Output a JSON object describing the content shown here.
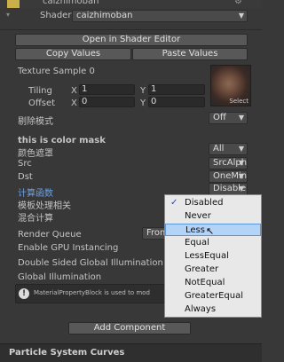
{
  "header": {
    "title": "caizhimoban",
    "shader_label": "Shader",
    "shader_value": "caizhimoban"
  },
  "buttons": {
    "open_shader_editor": "Open in Shader Editor",
    "copy_values": "Copy Values",
    "paste_values": "Paste Values",
    "add_component": "Add Component"
  },
  "texture": {
    "label": "Texture Sample 0",
    "select_label": "Select",
    "tiling": {
      "label": "Tiling",
      "x_label": "X",
      "x_value": "1",
      "y_label": "Y",
      "y_value": "1"
    },
    "offset": {
      "label": "Offset",
      "x_label": "X",
      "x_value": "0",
      "y_label": "Y",
      "y_value": "0"
    }
  },
  "props": {
    "cull_label": "剔除模式",
    "cull_value": "Off",
    "color_mask_label": "this is color mask",
    "color_mask_sub_label": "颜色遮罩",
    "color_mask_value": "All",
    "src_label": "Src",
    "src_value": "SrcAlph",
    "dst_label": "Dst",
    "dst_value": "OneMin",
    "compare_label": "计算函数",
    "compare_value": "Disable",
    "template_label": "模板处理相关",
    "blend_label": "混合计算",
    "render_queue_label": "Render Queue",
    "render_queue_value": "From",
    "gpu_instancing_label": "Enable GPU Instancing",
    "double_sided_label": "Double Sided Global Illumination",
    "global_illum_label": "Global Illumination"
  },
  "info": {
    "text": "MaterialPropertyBlock is used to mod",
    "icon": "info-icon"
  },
  "dropdown_menu": {
    "selected": "Disabled",
    "highlighted": "Less",
    "options": [
      "Disabled",
      "Never",
      "Less",
      "Equal",
      "LessEqual",
      "Greater",
      "NotEqual",
      "GreaterEqual",
      "Always"
    ]
  },
  "footer": {
    "title": "Particle System Curves"
  }
}
